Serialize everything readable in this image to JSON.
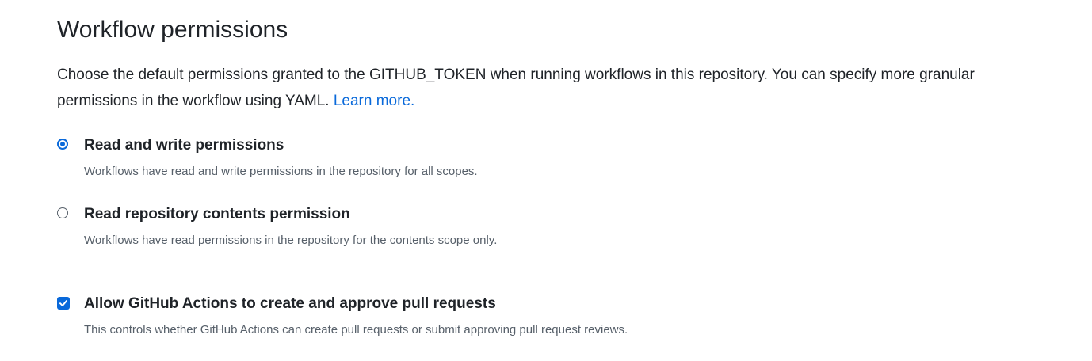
{
  "section": {
    "title": "Workflow permissions",
    "description": "Choose the default permissions granted to the GITHUB_TOKEN when running workflows in this repository. You can specify more granular permissions in the workflow using YAML.",
    "learn_more": "Learn more."
  },
  "permission_options": [
    {
      "label": "Read and write permissions",
      "note": "Workflows have read and write permissions in the repository for all scopes.",
      "selected": true
    },
    {
      "label": "Read repository contents permission",
      "note": "Workflows have read permissions in the repository for the contents scope only.",
      "selected": false
    }
  ],
  "pull_request_setting": {
    "label": "Allow GitHub Actions to create and approve pull requests",
    "note": "This controls whether GitHub Actions can create pull requests or submit approving pull request reviews.",
    "checked": true
  },
  "colors": {
    "accent": "#0969da",
    "text": "#1f2328",
    "muted": "#57606a",
    "divider": "#d8dee4"
  }
}
